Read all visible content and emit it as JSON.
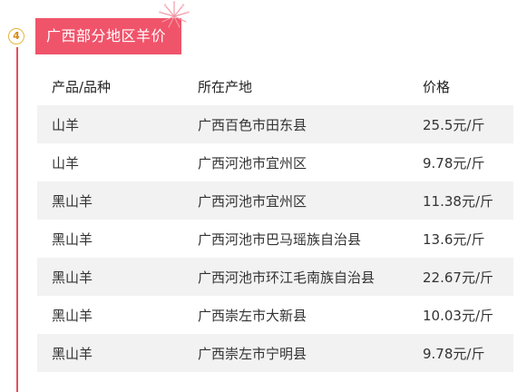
{
  "section": {
    "number": "4",
    "title": "广西部分地区羊价"
  },
  "colors": {
    "accent": "#f0546b",
    "timeline": "#e45060",
    "badge": "#e7b53c",
    "row_stripe": "#f2f2f2"
  },
  "table": {
    "headers": {
      "product": "产品/品种",
      "origin": "所在产地",
      "price": "价格"
    },
    "rows": [
      {
        "product": "山羊",
        "origin": "广西百色市田东县",
        "price": "25.5元/斤"
      },
      {
        "product": "山羊",
        "origin": "广西河池市宜州区",
        "price": "9.78元/斤"
      },
      {
        "product": "黑山羊",
        "origin": "广西河池市宜州区",
        "price": "11.38元/斤"
      },
      {
        "product": "黑山羊",
        "origin": "广西河池市巴马瑶族自治县",
        "price": "13.6元/斤"
      },
      {
        "product": "黑山羊",
        "origin": "广西河池市环江毛南族自治县",
        "price": "22.67元/斤"
      },
      {
        "product": "黑山羊",
        "origin": "广西崇左市大新县",
        "price": "10.03元/斤"
      },
      {
        "product": "黑山羊",
        "origin": "广西崇左市宁明县",
        "price": "9.78元/斤"
      }
    ]
  }
}
